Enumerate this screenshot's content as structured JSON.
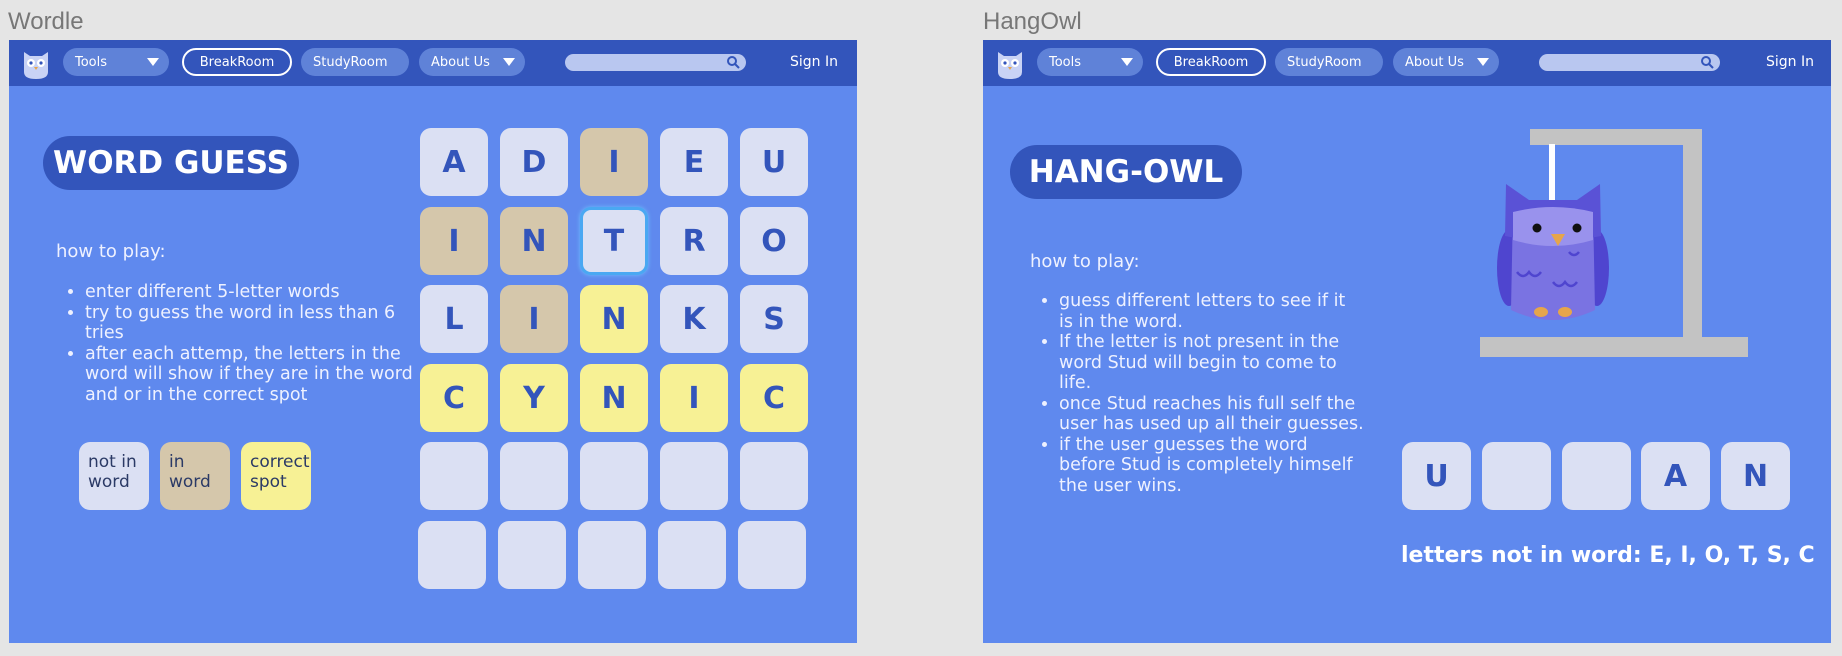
{
  "frames": {
    "wordle_label": "Wordle",
    "hangowl_label": "HangOwl"
  },
  "nav": {
    "tools": "Tools",
    "breakroom": "BreakRoom",
    "studyroom": "StudyRoom",
    "about": "About Us",
    "signin": "Sign In",
    "search_placeholder": ""
  },
  "wordle": {
    "title": "WORD GUESS",
    "how_to_play": "how to play:",
    "rules": [
      "enter different 5-letter words",
      "try to guess the word in less than 6 tries",
      "after each attemp, the letters in the word will show if they are in the word and or in the correct spot"
    ],
    "legend": {
      "not_in_word": "not in word",
      "in_word": "in word",
      "correct_spot": "correct spot"
    },
    "grid": [
      [
        "A",
        "D",
        "I",
        "E",
        "U"
      ],
      [
        "I",
        "N",
        "T",
        "R",
        "O"
      ],
      [
        "L",
        "I",
        "N",
        "K",
        "S"
      ],
      [
        "C",
        "Y",
        "N",
        "I",
        "C"
      ],
      [
        "",
        "",
        "",
        "",
        ""
      ],
      [
        "",
        "",
        "",
        "",
        ""
      ]
    ],
    "states": [
      [
        "none",
        "none",
        "in-word",
        "none",
        "none"
      ],
      [
        "in-word",
        "in-word",
        "none",
        "none",
        "none"
      ],
      [
        "none",
        "in-word",
        "correct",
        "none",
        "none"
      ],
      [
        "correct",
        "correct",
        "correct",
        "correct",
        "correct"
      ],
      [
        "empty",
        "empty",
        "empty",
        "empty",
        "empty"
      ],
      [
        "empty",
        "empty",
        "empty",
        "empty",
        "empty"
      ]
    ],
    "focused_cell": "row 2, column 3",
    "colors": {
      "not_in_word": "#dbe0f3",
      "in_word": "#d5c7ab",
      "correct": "#f7f195",
      "background": "#5f89ee",
      "navbar": "#3355bb"
    }
  },
  "hangowl": {
    "title": "HANG-OWL",
    "how_to_play": "how to play:",
    "rules": [
      "guess different letters to see if it is in the word.",
      "If the letter is not present in the word Stud will begin to come to life.",
      "once Stud reaches his full self the user has used up all their guesses.",
      "if the user guesses the word before Stud is completely himself the user wins."
    ],
    "word_slots": [
      "U",
      "",
      "",
      "A",
      "N"
    ],
    "not_in_word": "letters not in word: E, I, O, T, S, C",
    "owl_icon": "owl-icon"
  }
}
